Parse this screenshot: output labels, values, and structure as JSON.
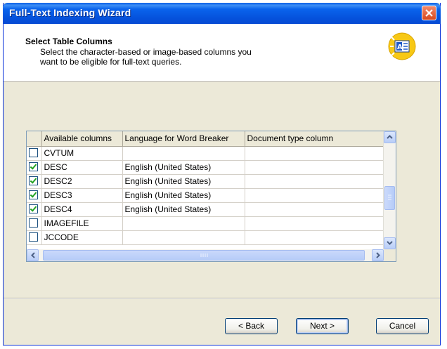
{
  "window": {
    "title": "Full-Text Indexing Wizard"
  },
  "header": {
    "title": "Select Table Columns",
    "description_line1": "Select the character-based or image-based columns you",
    "description_line2": "want to be eligible for full-text queries."
  },
  "grid": {
    "columns": [
      "Available columns",
      "Language for Word Breaker",
      "Document type column"
    ],
    "rows": [
      {
        "checked": false,
        "name": "CVTUM",
        "language": "",
        "doctype": ""
      },
      {
        "checked": true,
        "name": "DESC",
        "language": "English (United States)",
        "doctype": ""
      },
      {
        "checked": true,
        "name": "DESC2",
        "language": "English (United States)",
        "doctype": ""
      },
      {
        "checked": true,
        "name": "DESC3",
        "language": "English (United States)",
        "doctype": ""
      },
      {
        "checked": true,
        "name": "DESC4",
        "language": "English (United States)",
        "doctype": ""
      },
      {
        "checked": false,
        "name": "IMAGEFILE",
        "language": "",
        "doctype": ""
      },
      {
        "checked": false,
        "name": "JCCODE",
        "language": "",
        "doctype": ""
      }
    ]
  },
  "buttons": {
    "back": "< Back",
    "next": "Next >",
    "cancel": "Cancel"
  },
  "colors": {
    "titlebar": "#0a5ee6",
    "dialog_bg": "#ece9d8",
    "accent": "#0831d9"
  },
  "icons": {
    "close": "close-icon",
    "wizard": "fulltext-wizard-icon"
  }
}
